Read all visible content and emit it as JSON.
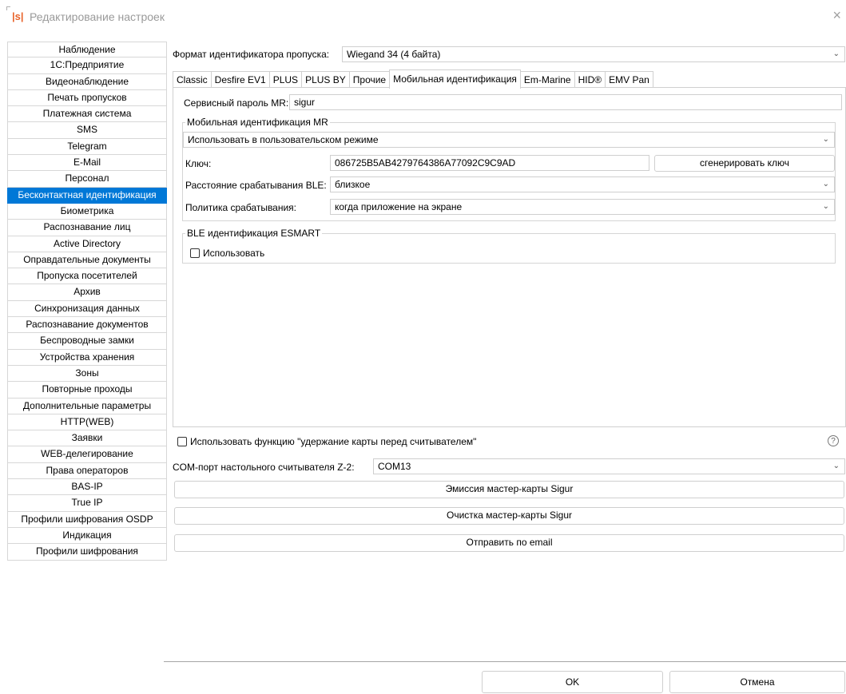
{
  "window": {
    "logo": "|s|",
    "title": "Редактирование настроек",
    "close_symbol": "×"
  },
  "sidebar": {
    "items": [
      {
        "label": "Наблюдение"
      },
      {
        "label": "1С:Предприятие"
      },
      {
        "label": "Видеонаблюдение"
      },
      {
        "label": "Печать пропусков"
      },
      {
        "label": "Платежная система"
      },
      {
        "label": "SMS"
      },
      {
        "label": "Telegram"
      },
      {
        "label": "E-Mail"
      },
      {
        "label": "Персонал"
      },
      {
        "label": "Бесконтактная идентификация",
        "active": true
      },
      {
        "label": "Биометрика"
      },
      {
        "label": "Распознавание лиц"
      },
      {
        "label": "Active Directory"
      },
      {
        "label": "Оправдательные документы"
      },
      {
        "label": "Пропуска посетителей"
      },
      {
        "label": "Архив"
      },
      {
        "label": "Синхронизация данных"
      },
      {
        "label": "Распознавание документов"
      },
      {
        "label": "Беспроводные замки"
      },
      {
        "label": "Устройства хранения"
      },
      {
        "label": "Зоны"
      },
      {
        "label": "Повторные проходы"
      },
      {
        "label": "Дополнительные параметры"
      },
      {
        "label": "HTTP(WEB)"
      },
      {
        "label": "Заявки"
      },
      {
        "label": "WEB-делегирование"
      },
      {
        "label": "Права операторов"
      },
      {
        "label": "BAS-IP"
      },
      {
        "label": "True IP"
      },
      {
        "label": "Профили шифрования OSDP"
      },
      {
        "label": "Индикация"
      },
      {
        "label": "Профили шифрования"
      }
    ]
  },
  "format": {
    "label": "Формат идентификатора пропуска:",
    "value": "Wiegand 34 (4 байта)"
  },
  "tabs": [
    {
      "label": "Classic"
    },
    {
      "label": "Desfire EV1"
    },
    {
      "label": "PLUS"
    },
    {
      "label": "PLUS BY"
    },
    {
      "label": "Прочие"
    },
    {
      "label": "Мобильная идентификация",
      "active": true
    },
    {
      "label": "Em-Marine"
    },
    {
      "label": "HID®"
    },
    {
      "label": "EMV Pan"
    }
  ],
  "mobile": {
    "service_password_label": "Сервисный пароль MR:",
    "service_password_value": "sigur",
    "group_title": "Мобильная идентификация MR",
    "mode_value": "Использовать в пользовательском режиме",
    "key_label": "Ключ:",
    "key_value": "086725B5AB4279764386A77092C9C9AD",
    "generate_key_button": "сгенерировать ключ",
    "ble_distance_label": "Расстояние срабатывания BLE:",
    "ble_distance_value": "близкое",
    "policy_label": "Политика срабатывания:",
    "policy_value": "когда приложение на экране",
    "esmart_group_title": "BLE идентификация ESMART",
    "esmart_use_label": "Использовать"
  },
  "bottom": {
    "hold_card_label": "Использовать функцию \"удержание карты перед считывателем\"",
    "com_port_label": "COM-порт настольного считывателя Z-2:",
    "com_port_value": "COM13",
    "emission_button": "Эмиссия мастер-карты Sigur",
    "clear_button": "Очистка мастер-карты Sigur",
    "send_email_button": "Отправить по email",
    "help_symbol": "?"
  },
  "dialog": {
    "ok_button": "OK",
    "cancel_button": "Отмена"
  },
  "colors": {
    "accent": "#0078d7",
    "logo": "#e8642c"
  }
}
